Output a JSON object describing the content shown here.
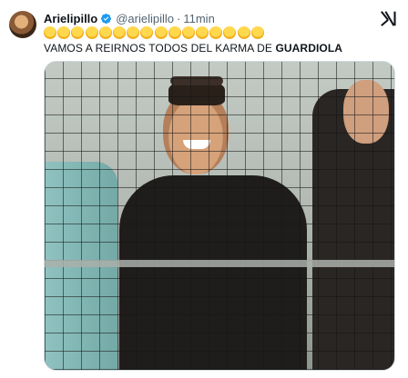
{
  "tweet": {
    "display_name": "Arielipillo",
    "handle": "@arielipillo",
    "separator": "·",
    "time": "11min",
    "emoji_icons": [
      "rofl-emoji",
      "rofl-emoji",
      "rofl-emoji",
      "rofl-emoji",
      "rofl-emoji",
      "rofl-emoji",
      "rofl-emoji",
      "rofl-emoji",
      "rofl-emoji",
      "rofl-emoji",
      "rofl-emoji",
      "rofl-emoji",
      "rofl-emoji",
      "rofl-emoji",
      "rofl-emoji",
      "rofl-emoji"
    ],
    "caption_plain": "VAMOS A REIRNOS TODOS DEL KARMA DE ",
    "caption_bold": "GUARDIOLA"
  },
  "icons": {
    "verified": "verified-badge-icon",
    "grok": "grok-icon"
  },
  "colors": {
    "verified_blue": "#1d9bf0",
    "secondary_text": "#536471",
    "primary_text": "#0f1419"
  }
}
